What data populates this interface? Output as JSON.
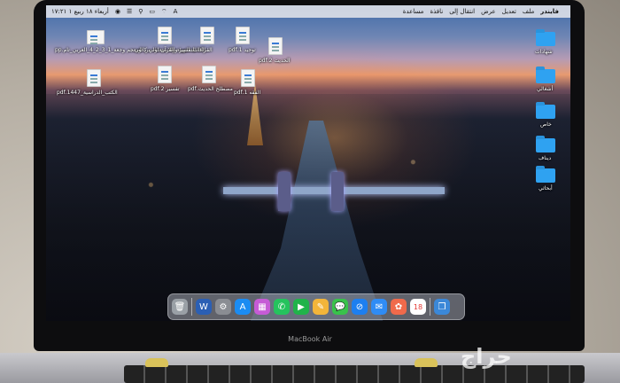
{
  "menubar": {
    "clock": "أربعاء ١٨ ربيع ١ ١٧:٢١",
    "items_right": [
      "فايندر",
      "ملف",
      "تعديل",
      "عرض",
      "انتقال إلى",
      "نافذة",
      "مساعدة"
    ],
    "apple": "",
    "status_icons": [
      "siri-icon",
      "control-center-icon",
      "spotlight-icon",
      "battery-icon",
      "wifi-icon",
      "input-a-icon"
    ],
    "input_source": "A"
  },
  "desktop": {
    "files": [
      {
        "label": "الكتاب التهيئة والاستعداد من المعجم وجعة_1_3_2_4_العربي_تام.pp"
      },
      {
        "label": "التفسير والقرآن لولي كاتون"
      },
      {
        "label": "القراءات"
      },
      {
        "label": "توحيد 1.pdf"
      },
      {
        "label": "الحديث 2.pdf"
      },
      {
        "label": "الكتب_الدراسية_1447.pdf"
      },
      {
        "label": "تفسير 2.pdf"
      },
      {
        "label": "مصطلح الحديث.pdf"
      },
      {
        "label": "الفقه 1.pdf"
      }
    ],
    "folders": [
      {
        "label": "شهادات"
      },
      {
        "label": "أشغالي"
      },
      {
        "label": "خاص"
      },
      {
        "label": "ديناف"
      },
      {
        "label": "أبحاثي"
      }
    ]
  },
  "dock": {
    "apps": [
      "finder-icon",
      "word-icon",
      "system-settings-icon",
      "app-store-icon",
      "launchpad-icon",
      "whatsapp-icon",
      "facetime-icon",
      "notes-icon",
      "messages-icon",
      "safari-icon",
      "mail-icon",
      "photos-icon",
      "calendar-icon",
      "files-icon"
    ],
    "calendar_day": "18"
  },
  "device": {
    "brand": "MacBook Air"
  },
  "watermark": "حراج"
}
